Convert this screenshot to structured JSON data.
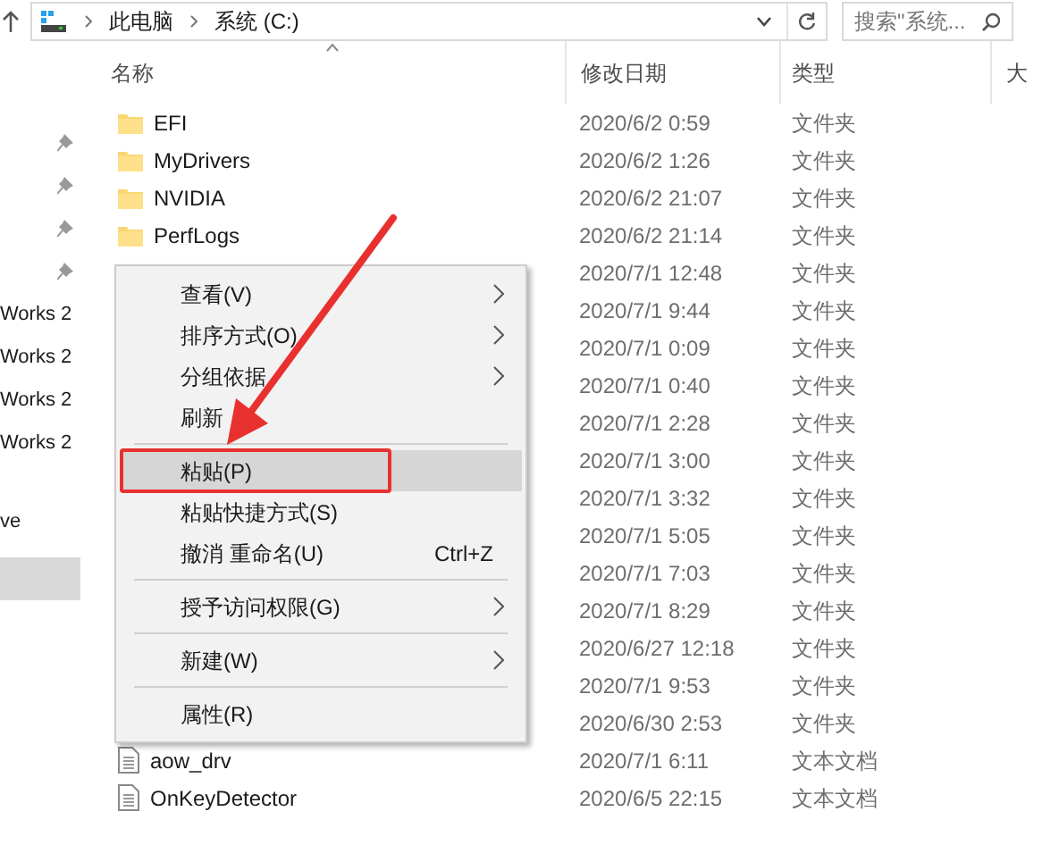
{
  "address_bar": {
    "path": [
      "此电脑",
      "系统 (C:)"
    ],
    "search_placeholder": "搜索\"系统..."
  },
  "sidebar": {
    "items": [
      {
        "pinned": true,
        "selected": false
      },
      {
        "pinned": true,
        "selected": false
      },
      {
        "pinned": true,
        "selected": false
      },
      {
        "pinned": true,
        "selected": false
      },
      {
        "label": "Works 2",
        "pinned": false,
        "selected": false
      },
      {
        "label": "Works 2",
        "pinned": false,
        "selected": false
      },
      {
        "label": "Works 2",
        "pinned": false,
        "selected": false
      },
      {
        "label": "Works 2",
        "pinned": false,
        "selected": false
      },
      {
        "label": "ve",
        "pinned": false,
        "selected": false
      },
      {
        "pinned": false,
        "selected": true
      }
    ]
  },
  "columns": [
    "名称",
    "修改日期",
    "类型",
    "大"
  ],
  "rows": [
    {
      "name": "EFI",
      "kind": "folder",
      "modified": "2020/6/2 0:59",
      "type": "文件夹"
    },
    {
      "name": "MyDrivers",
      "kind": "folder",
      "modified": "2020/6/2 1:26",
      "type": "文件夹"
    },
    {
      "name": "NVIDIA",
      "kind": "folder",
      "modified": "2020/6/2 21:07",
      "type": "文件夹"
    },
    {
      "name": "PerfLogs",
      "kind": "folder",
      "modified": "2020/6/2 21:14",
      "type": "文件夹"
    },
    {
      "modified": "2020/7/1 12:48",
      "type": "文件夹"
    },
    {
      "modified": "2020/7/1 9:44",
      "type": "文件夹"
    },
    {
      "modified": "2020/7/1 0:09",
      "type": "文件夹"
    },
    {
      "modified": "2020/7/1 0:40",
      "type": "文件夹"
    },
    {
      "modified": "2020/7/1 2:28",
      "type": "文件夹"
    },
    {
      "modified": "2020/7/1 3:00",
      "type": "文件夹"
    },
    {
      "modified": "2020/7/1 3:32",
      "type": "文件夹"
    },
    {
      "modified": "2020/7/1 5:05",
      "type": "文件夹"
    },
    {
      "modified": "2020/7/1 7:03",
      "type": "文件夹"
    },
    {
      "modified": "2020/7/1 8:29",
      "type": "文件夹"
    },
    {
      "modified": "2020/6/27 12:18",
      "type": "文件夹"
    },
    {
      "modified": "2020/7/1 9:53",
      "type": "文件夹"
    },
    {
      "modified": "2020/6/30 2:53",
      "type": "文件夹"
    },
    {
      "name": "aow_drv",
      "kind": "file",
      "modified": "2020/7/1 6:11",
      "type": "文本文档"
    },
    {
      "name": "OnKeyDetector",
      "kind": "file",
      "modified": "2020/6/5 22:15",
      "type": "文本文档"
    }
  ],
  "context_menu": {
    "items": [
      {
        "kind": "command",
        "label": "查看(V)",
        "submenu": true,
        "selected": false
      },
      {
        "kind": "command",
        "label": "排序方式(O)",
        "submenu": true,
        "selected": false
      },
      {
        "kind": "command",
        "label": "分组依据",
        "submenu": true,
        "selected": false
      },
      {
        "kind": "command",
        "label": "刷新",
        "submenu": false,
        "selected": false
      },
      {
        "kind": "separator"
      },
      {
        "kind": "command",
        "label": "粘贴(P)",
        "submenu": false,
        "selected": true,
        "marked": true
      },
      {
        "kind": "command",
        "label": "粘贴快捷方式(S)",
        "submenu": false,
        "selected": false
      },
      {
        "kind": "command",
        "label": "撤消 重命名(U)",
        "shortcut": "Ctrl+Z",
        "submenu": false,
        "selected": false
      },
      {
        "kind": "separator"
      },
      {
        "kind": "command",
        "label": "授予访问权限(G)",
        "submenu": true,
        "selected": false
      },
      {
        "kind": "separator"
      },
      {
        "kind": "command",
        "label": "新建(W)",
        "submenu": true,
        "selected": false
      },
      {
        "kind": "separator"
      },
      {
        "kind": "command",
        "label": "属性(R)",
        "submenu": false,
        "selected": false
      }
    ]
  },
  "annotation_arrow": true
}
